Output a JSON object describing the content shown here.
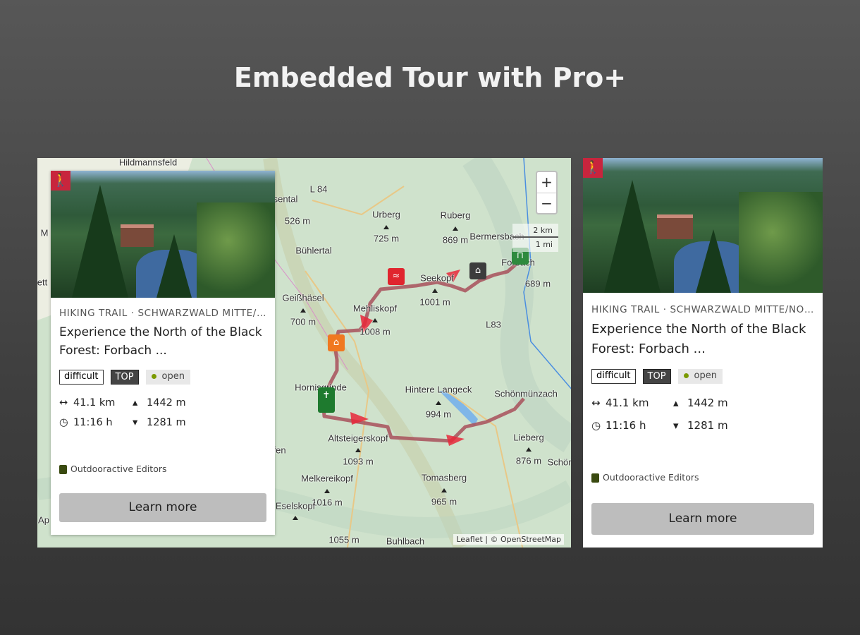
{
  "page_title": "Embedded Tour with Pro+",
  "map": {
    "zoom_in": "+",
    "zoom_out": "−",
    "scale_km": "2 km",
    "scale_mi": "1 mi",
    "attribution": "Leaflet | © OpenStreetMap",
    "labels": [
      "Hildmannsfeld",
      "L 84",
      "sental",
      "526 m",
      "Urberg",
      "725 m",
      "Ruberg",
      "869 m",
      "Bermersbach",
      "Bühlertal",
      "Seekopf",
      "1001 m",
      "Forbach",
      "689 m",
      "Geißhäsel",
      "700 m",
      "Mehliskopf",
      "1008 m",
      "L83",
      "Hornisgrinde",
      "Hintere Langeck",
      "994 m",
      "Schönmünzach",
      "Altsteigerskopf",
      "1093 m",
      "Lieberg",
      "876 m",
      "Schön",
      "Melkereikopf",
      "1016 m",
      "Tomasberg",
      "965 m",
      "Eselskopf",
      "1055 m",
      "Buhlbach",
      "M",
      "ett",
      "öfen",
      "Ap"
    ],
    "route_color": "#a8505a",
    "direction_arrow_color": "#e8283a"
  },
  "tour": {
    "activity_icon": "hiking-icon",
    "activity_color": "#c8253d",
    "category": "HIKING TRAIL · SCHWARZWALD MITTE/NORDSCHWARZWALD",
    "title": "Experience the North of the Black Forest: Forbach ...",
    "badges": {
      "difficulty": "difficult",
      "top": "TOP",
      "status": "open"
    },
    "status_color": "#7a9a00",
    "distance": "41.1 km",
    "ascent": "1442 m",
    "duration": "11:16 h",
    "descent": "1281 m",
    "author": "Outdooractive Editors",
    "learn_more": "Learn more"
  }
}
